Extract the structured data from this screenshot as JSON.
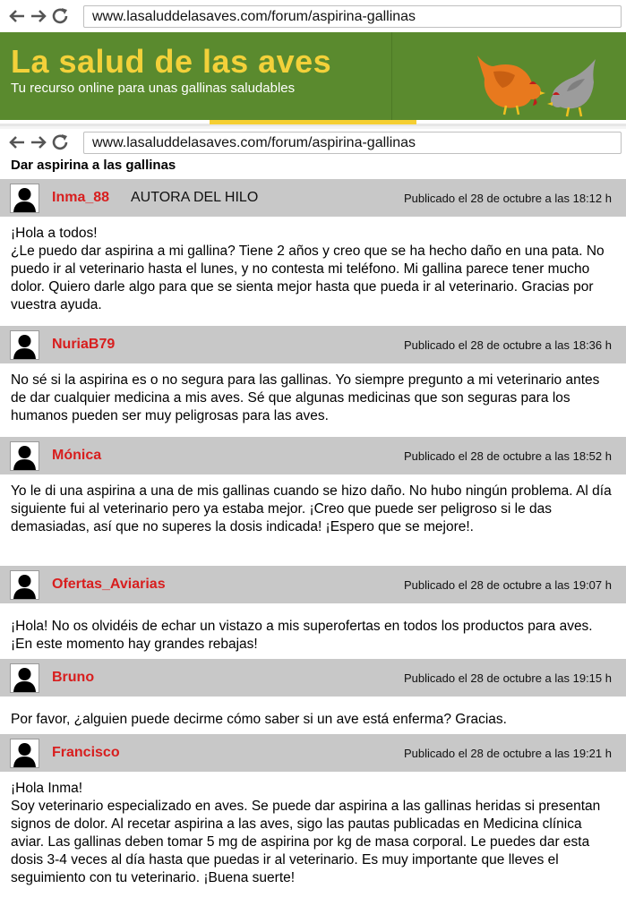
{
  "browser": {
    "url": "www.lasaluddelasaves.com/forum/aspirina-gallinas",
    "back_icon": "arrow-left-icon",
    "forward_icon": "arrow-right-icon",
    "reload_icon": "reload-icon"
  },
  "banner": {
    "title": "La salud de las aves",
    "subtitle": "Tu recurso online para unas gallinas saludables",
    "colors": {
      "background": "#5a8a2e",
      "title": "#f3d13a"
    }
  },
  "thread": {
    "title": "Dar aspirina a las gallinas",
    "author_tag": "AUTORA DEL HILO",
    "posts": [
      {
        "user": "Inma_88",
        "date": "Publicado el 28 de octubre a las 18:12 h",
        "lines": [
          "¡Hola a todos!",
          "¿Le puedo dar aspirina a mi gallina? Tiene 2 años y creo que se ha hecho daño en una pata. No puedo ir al veterinario hasta el lunes, y no contesta mi teléfono. Mi gallina parece tener mucho dolor. Quiero darle algo para que se sienta mejor hasta que pueda ir al veterinario. Gracias por vuestra ayuda."
        ]
      },
      {
        "user": "NuriaB79",
        "date": "Publicado el 28 de octubre a las 18:36 h",
        "lines": [
          "No sé si la aspirina es o no segura para las gallinas. Yo siempre pregunto a mi veterinario antes de dar cualquier medicina a mis aves. Sé que algunas medicinas que son seguras para los humanos pueden ser muy peligrosas para las aves."
        ]
      },
      {
        "user": "Mónica",
        "date": "Publicado el 28 de octubre a las 18:52 h",
        "lines": [
          "Yo le di una aspirina a una de mis gallinas cuando se hizo daño. No hubo ningún problema. Al día siguiente fui al veterinario pero ya estaba mejor. ¡Creo que puede ser peligroso si le das demasiadas, así que no superes la dosis indicada! ¡Espero que se mejore!."
        ]
      },
      {
        "user": "Ofertas_Aviarias",
        "date": "Publicado el 28 de octubre a las 19:07 h",
        "lines": [
          "¡Hola! No os olvidéis de echar un vistazo a mis superofertas en todos los productos para aves. ¡En este momento hay grandes rebajas!"
        ]
      },
      {
        "user": "Bruno",
        "date": "Publicado el 28 de octubre a las 19:15 h",
        "lines": [
          "Por favor, ¿alguien puede decirme cómo saber si un ave está enferma? Gracias."
        ]
      },
      {
        "user": "Francisco",
        "date": "Publicado el 28 de octubre a las 19:21 h",
        "lines": [
          "¡Hola Inma!",
          "Soy veterinario especializado en aves. Se puede dar aspirina a las gallinas heridas si presentan signos de dolor. Al recetar aspirina a las aves, sigo las pautas publicadas en Medicina clínica aviar. Las gallinas deben tomar 5 mg de aspirina por kg de masa corporal. Le puedes dar esta dosis 3-4 veces al día hasta que puedas ir al veterinario. Es muy importante que lleves el seguimiento con tu veterinario. ¡Buena suerte!"
        ]
      }
    ]
  }
}
